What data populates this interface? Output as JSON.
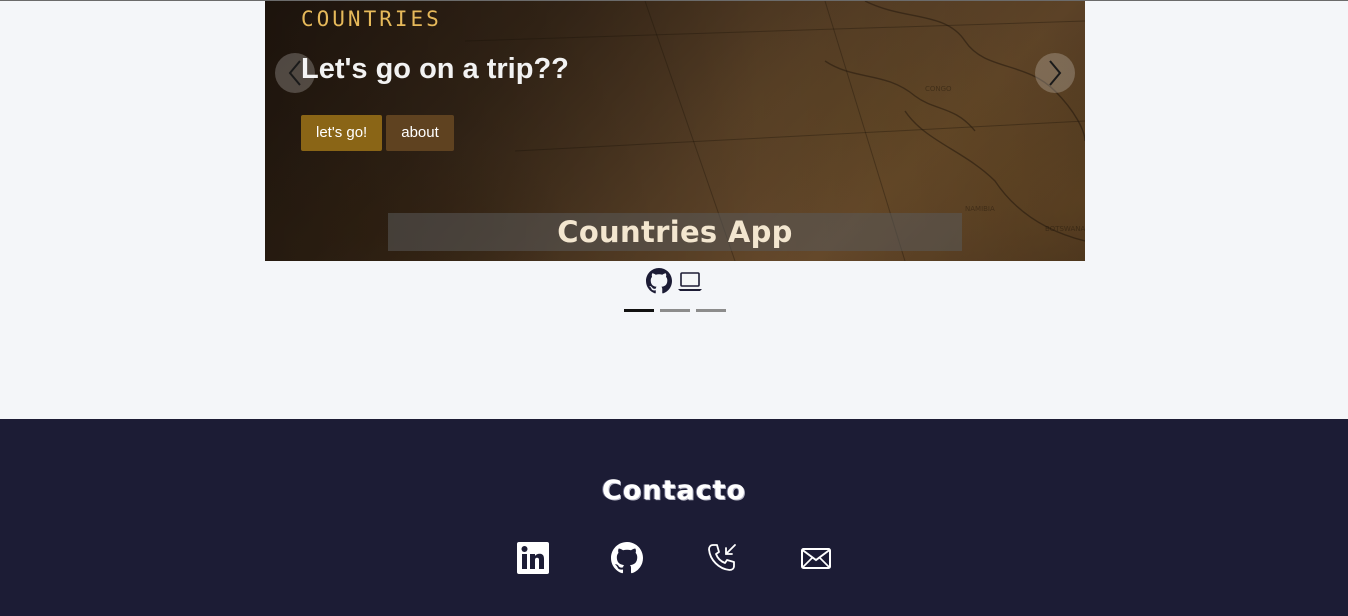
{
  "carousel": {
    "slide": {
      "kicker": "COUNTRIES",
      "heading": "Let's go on a trip??",
      "primary_button": "let's go!",
      "secondary_button": "about",
      "caption": "Countries App"
    },
    "prev_icon": "chevron-left-icon",
    "next_icon": "chevron-right-icon",
    "project_links": [
      "github-icon",
      "laptop-icon"
    ],
    "indicators": {
      "count": 3,
      "active_index": 0
    }
  },
  "footer": {
    "title": "Contacto",
    "icons": [
      "linkedin-icon",
      "github-icon",
      "phone-icon",
      "mail-icon"
    ]
  },
  "colors": {
    "page_bg": "#f4f6f9",
    "footer_bg": "#1c1c35",
    "kicker": "#e6b95a",
    "button_primary": "#8a6516",
    "button_secondary": "#5f4220"
  }
}
